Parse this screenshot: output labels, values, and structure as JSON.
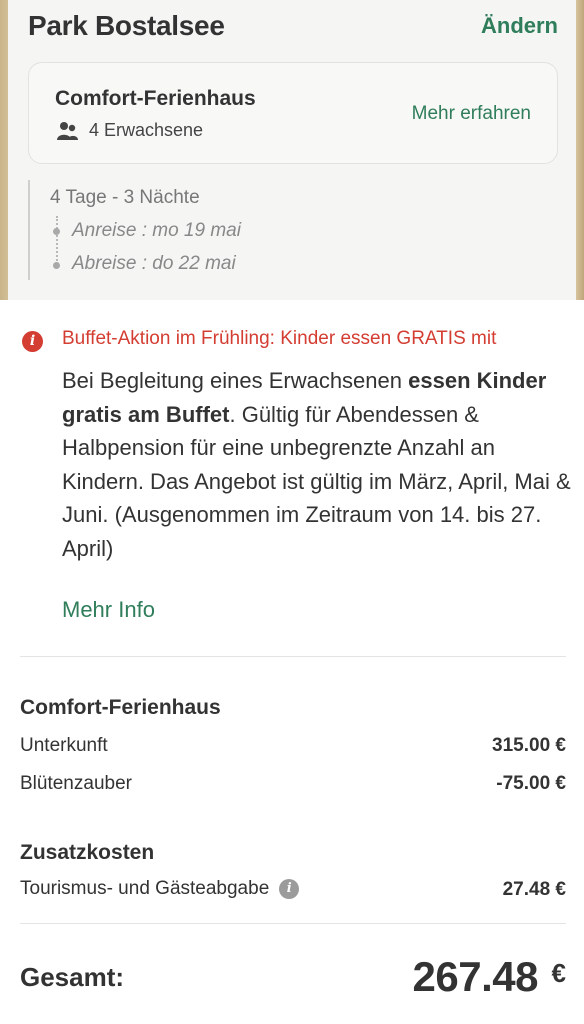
{
  "header": {
    "park_name": "Park Bostalsee",
    "change_label": "Ändern"
  },
  "room": {
    "name": "Comfort-Ferienhaus",
    "guests": "4 Erwachsene",
    "guests_icon": "people-icon",
    "more_label": "Mehr erfahren"
  },
  "stay": {
    "duration": "4 Tage - 3 Nächte",
    "arrival": "Anreise : mo 19 mai",
    "departure": "Abreise : do 22 mai"
  },
  "promo": {
    "icon": "alert-icon",
    "title": "Buffet-Aktion im Frühling: Kinder essen GRATIS mit",
    "body_pre": "Bei Begleitung eines Erwachsenen ",
    "body_bold": "essen Kinder gratis am Buffet",
    "body_post": ". Gültig für Abendessen & Halbpension für eine unbegrenzte Anzahl an Kindern. Das Angebot ist gültig im März, April, Mai & Juni. (Ausgenommen im Zeitraum von 14. bis 27. April)",
    "more_label": "Mehr Info"
  },
  "pricing": {
    "accommodation_title": "Comfort-Ferienhaus",
    "lines": [
      {
        "label": "Unterkunft",
        "value": "315.00 €"
      },
      {
        "label": "Blütenzauber",
        "value": "-75.00 €"
      }
    ],
    "extras_title": "Zusatzkosten",
    "extras": [
      {
        "label": "Tourismus- und Gästeabgabe",
        "value": "27.48 €",
        "icon": "info-icon"
      }
    ],
    "total_label": "Gesamt:",
    "total_value": "267.48",
    "total_currency": "€"
  },
  "colors": {
    "accent_green": "#2f7d5a",
    "alert_red": "#d43d32"
  }
}
